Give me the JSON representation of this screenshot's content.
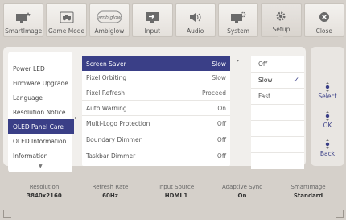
{
  "tabs": [
    {
      "label": "SmartImage",
      "icon": "smartimage-icon"
    },
    {
      "label": "Game Mode",
      "icon": "gamepad-icon"
    },
    {
      "label": "Ambiglow",
      "icon": "ambiglow-icon",
      "icon_text": "ambiglow"
    },
    {
      "label": "Input",
      "icon": "input-icon"
    },
    {
      "label": "Audio",
      "icon": "speaker-icon"
    },
    {
      "label": "System",
      "icon": "system-icon"
    },
    {
      "label": "Setup",
      "icon": "gear-icon"
    },
    {
      "label": "Close",
      "icon": "close-icon"
    }
  ],
  "active_tab": "Setup",
  "menu": {
    "categories": [
      "Power LED",
      "Firmware Upgrade",
      "Language",
      "Resolution Notice",
      "OLED Panel Care",
      "OLED Information",
      "Information"
    ],
    "selected_category": "OLED Panel Care",
    "settings": [
      {
        "label": "Screen Saver",
        "value": "Slow"
      },
      {
        "label": "Pixel Orbiting",
        "value": "Slow"
      },
      {
        "label": "Pixel Refresh",
        "value": "Proceed"
      },
      {
        "label": "Auto Warning",
        "value": "On"
      },
      {
        "label": "Multi-Logo Protection",
        "value": "Off"
      },
      {
        "label": "Boundary Dimmer",
        "value": "Off"
      },
      {
        "label": "Taskbar Dimmer",
        "value": "Off"
      }
    ],
    "selected_setting": "Screen Saver",
    "options": [
      "Off",
      "Slow",
      "Fast"
    ],
    "selected_option": "Slow"
  },
  "controls": {
    "select": "Select",
    "ok": "OK",
    "back": "Back"
  },
  "info": [
    {
      "key": "Resolution",
      "value": "3840x2160"
    },
    {
      "key": "Refresh Rate",
      "value": "60Hz"
    },
    {
      "key": "Input Source",
      "value": "HDMI 1"
    },
    {
      "key": "Adaptive Sync",
      "value": "On"
    },
    {
      "key": "SmartImage",
      "value": "Standard"
    }
  ],
  "colors": {
    "accent": "#3a3f87",
    "background": "#d5d0ca"
  }
}
